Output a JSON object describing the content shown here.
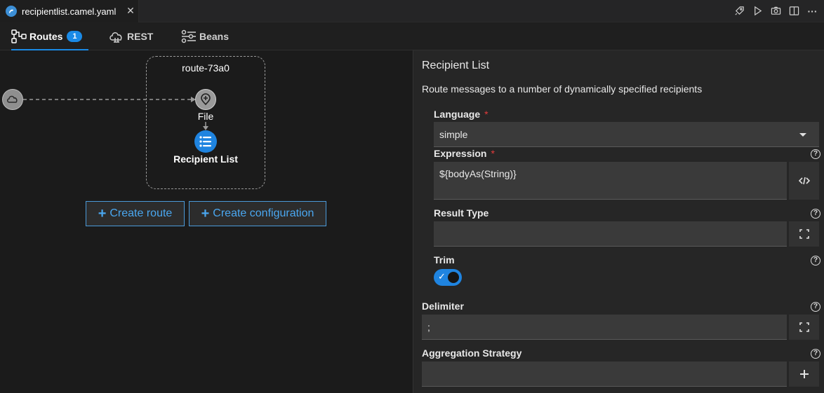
{
  "editor_tab": {
    "title": "recipientlist.camel.yaml",
    "close_glyph": "✕"
  },
  "toolbar": {
    "icons": [
      "rocket-icon",
      "play-icon",
      "camera-icon",
      "split-editor-icon",
      "more-icon"
    ],
    "more_glyph": "···"
  },
  "view_tabs": [
    {
      "label": "Routes",
      "badge": "1",
      "active": true,
      "icon": "routes-icon"
    },
    {
      "label": "REST",
      "active": false,
      "icon": "cloud-icon"
    },
    {
      "label": "Beans",
      "active": false,
      "icon": "beans-icon"
    }
  ],
  "canvas": {
    "route_title": "route-73a0",
    "nodes": [
      {
        "label": "File",
        "icon": "file-endpoint-icon"
      },
      {
        "label": "Recipient List",
        "icon": "recipient-list-icon"
      }
    ],
    "create_route_label": "Create route",
    "create_configuration_label": "Create configuration",
    "plus_glyph": "+"
  },
  "panel": {
    "title": "Recipient List",
    "description": "Route messages to a number of dynamically specified recipients",
    "language": {
      "label": "Language",
      "required_mark": "*",
      "value": "simple"
    },
    "expression": {
      "label": "Expression",
      "required_mark": "*",
      "value": "${bodyAs(String)}"
    },
    "result_type": {
      "label": "Result Type",
      "value": ""
    },
    "trim": {
      "label": "Trim",
      "enabled": true
    },
    "delimiter": {
      "label": "Delimiter",
      "value": ";"
    },
    "aggregation_strategy": {
      "label": "Aggregation Strategy",
      "value": ""
    },
    "help_glyph": "?"
  },
  "colors": {
    "accent": "#1a8ae6",
    "required": "#e23b3b",
    "link": "#4aa7f0"
  }
}
